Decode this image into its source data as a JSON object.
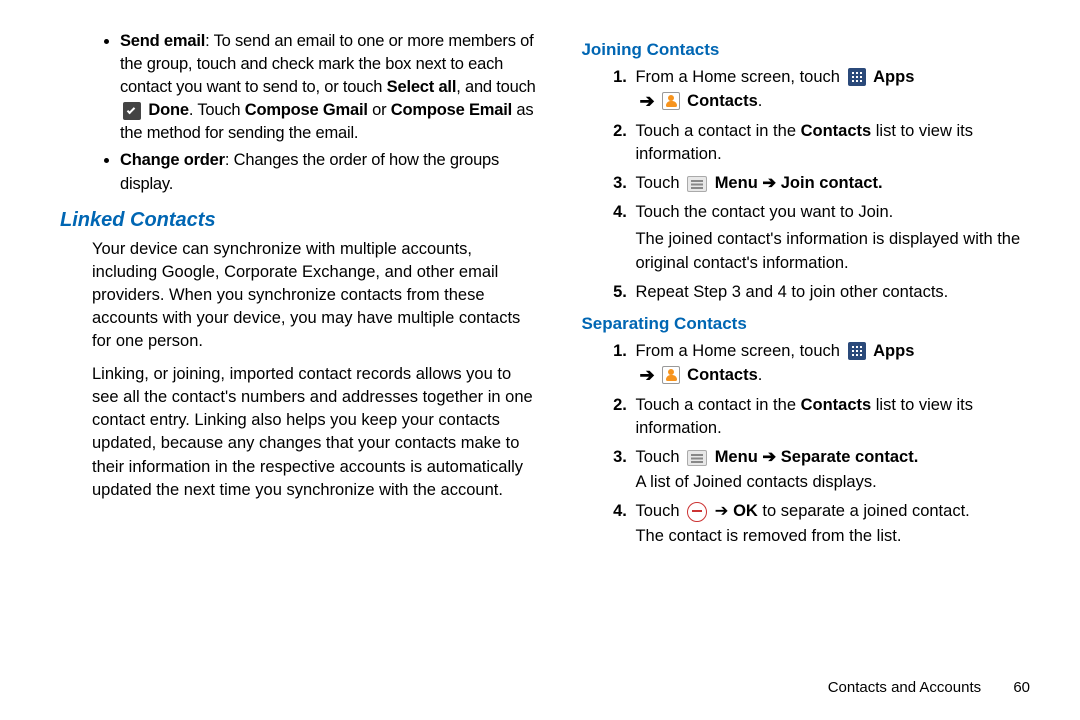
{
  "left": {
    "bullets": {
      "sendEmail": {
        "label": "Send email",
        "part1": ": To send an email to one or more members of the group, touch and check mark the box next to each contact you want to send to, or touch ",
        "selectAll": "Select all",
        "part2": ", and touch ",
        "done": "Done",
        "part3": ". Touch ",
        "composeGmail": "Compose Gmail",
        "or": " or ",
        "composeEmail": "Compose Email",
        "part4": " as the method for sending the email."
      },
      "changeOrder": {
        "label": "Change order",
        "text": ": Changes the order of how the groups display."
      }
    },
    "linkedTitle": "Linked Contacts",
    "linkedP1": "Your device can synchronize with multiple accounts, including Google, Corporate Exchange, and other email providers. When you synchronize contacts from these accounts with your device, you may have multiple contacts for one person.",
    "linkedP2": "Linking, or joining, imported contact records allows you to see all the contact's numbers and addresses together in one contact entry. Linking also helps you keep your contacts updated, because any changes that your contacts make to their information in the respective accounts is automatically updated the next time you synchronize with the account."
  },
  "right": {
    "joiningTitle": "Joining Contacts",
    "joining": {
      "s1a": "From a Home screen, touch ",
      "apps": "Apps",
      "contacts": "Contacts",
      "s2a": "Touch a contact in the ",
      "contactsBold": "Contacts",
      "s2b": " list to view its information.",
      "s3a": "Touch ",
      "menuJoin": "Menu ➔ Join contact.",
      "s4": "Touch the contact you want to Join.",
      "s4b": "The joined contact's information is displayed with the original contact's information.",
      "s5": "Repeat Step 3 and 4 to join other contacts."
    },
    "separatingTitle": "Separating Contacts",
    "separating": {
      "s1a": "From a Home screen, touch ",
      "apps": "Apps",
      "contacts": "Contacts",
      "s2a": "Touch a contact in the ",
      "contactsBold": "Contacts",
      "s2b": " list to view its information.",
      "s3a": "Touch ",
      "menuSep": "Menu ➔ Separate contact.",
      "s3b": "A list of Joined contacts displays.",
      "s4a": "Touch ",
      "s4b": " ➔ ",
      "ok": "OK",
      "s4c": " to separate a joined contact.",
      "s4d": "The contact is removed from the list."
    }
  },
  "footer": {
    "section": "Contacts and Accounts",
    "page": "60"
  }
}
